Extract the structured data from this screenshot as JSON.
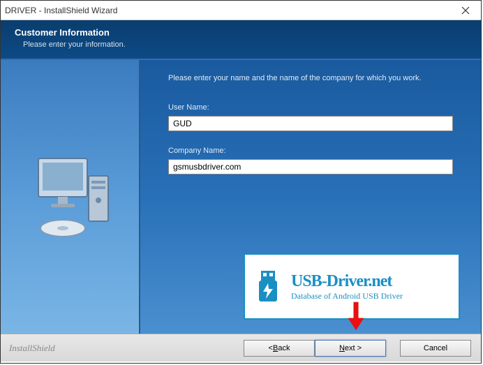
{
  "window": {
    "title": "DRIVER - InstallShield Wizard"
  },
  "header": {
    "title": "Customer Information",
    "subtitle": "Please enter your information."
  },
  "content": {
    "instruction": "Please enter your name and the name of the company for which you work.",
    "user_name_label": "User Name:",
    "user_name_value": "GUD",
    "company_name_label": "Company Name:",
    "company_name_value": "gsmusbdriver.com"
  },
  "watermark": {
    "title": "USB-Driver.net",
    "subtitle": "Database of Android USB Driver"
  },
  "footer": {
    "brand": "InstallShield",
    "back_label": "< Back",
    "next_label": "Next >",
    "cancel_label": "Cancel"
  }
}
